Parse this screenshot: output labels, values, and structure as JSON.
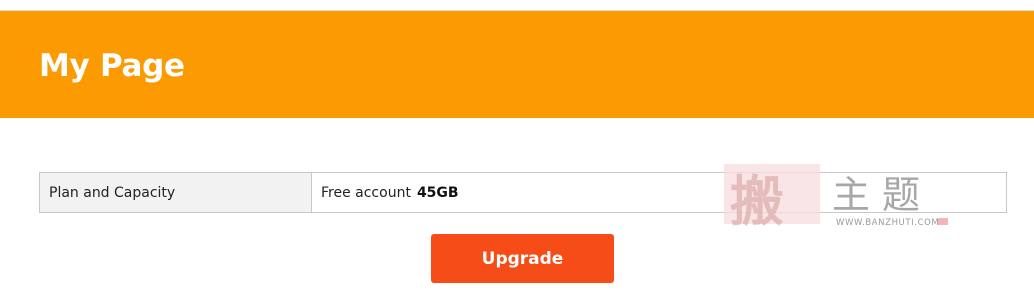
{
  "header": {
    "title": "My Page",
    "background_color": "#fb9a01"
  },
  "plan": {
    "label": "Plan and Capacity",
    "account_type": "Free account",
    "capacity": "45GB"
  },
  "actions": {
    "upgrade_label": "Upgrade",
    "upgrade_color": "#f64c17"
  },
  "watermark": {
    "text": "主题",
    "url": "WWW.BANZHUTI.COM"
  }
}
